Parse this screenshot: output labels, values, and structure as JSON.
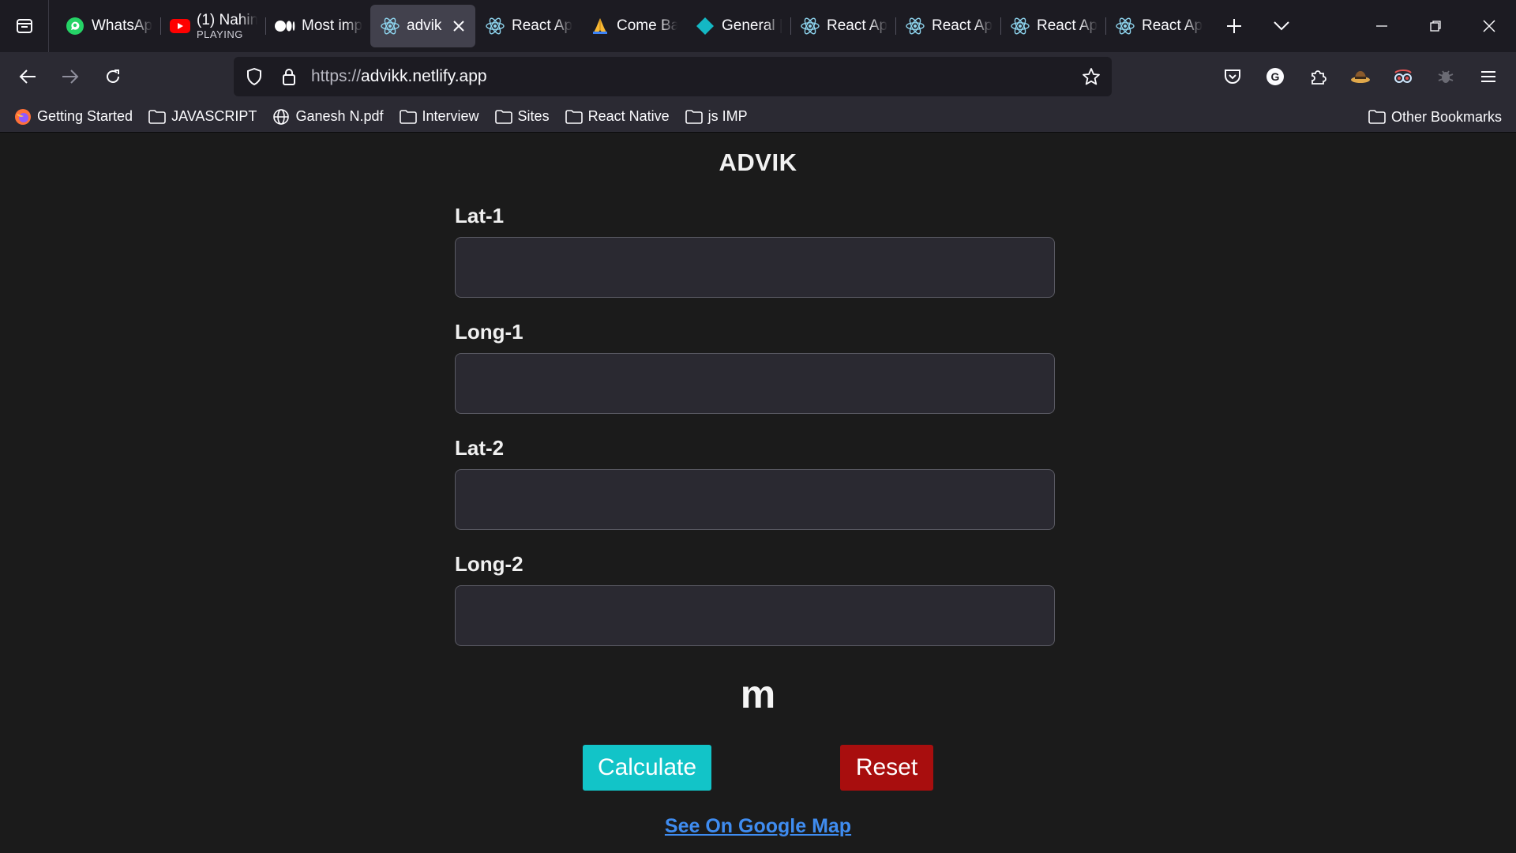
{
  "browser": {
    "tabs": [
      {
        "title": "WhatsApp",
        "icon": "whatsapp-icon"
      },
      {
        "title": "(1) Nahin",
        "subtitle": "PLAYING",
        "icon": "youtube-icon"
      },
      {
        "title": "Most imp",
        "icon": "medium-icon"
      },
      {
        "title": "advik",
        "icon": "react-icon",
        "active": true
      },
      {
        "title": "React Ap",
        "icon": "react-icon"
      },
      {
        "title": "Come Ba",
        "icon": "praying-hands-icon"
      },
      {
        "title": "General |",
        "icon": "diamond-icon"
      },
      {
        "title": "React Ap",
        "icon": "react-icon"
      },
      {
        "title": "React Ap",
        "icon": "react-icon"
      },
      {
        "title": "React Ap",
        "icon": "react-icon"
      },
      {
        "title": "React Ap",
        "icon": "react-icon"
      }
    ],
    "url_scheme": "https://",
    "url_host": "advikk.netlify.app",
    "bookmarks": [
      "Getting Started",
      "JAVASCRIPT",
      "Ganesh N.pdf",
      "Interview",
      "Sites",
      "React Native",
      "js IMP"
    ],
    "other_bookmarks": "Other Bookmarks"
  },
  "app": {
    "title": "ADVIK",
    "fields": [
      {
        "label": "Lat-1",
        "value": ""
      },
      {
        "label": "Long-1",
        "value": ""
      },
      {
        "label": "Lat-2",
        "value": ""
      },
      {
        "label": "Long-2",
        "value": ""
      }
    ],
    "result": "m",
    "calculate_label": "Calculate",
    "reset_label": "Reset",
    "map_link": "See On Google Map"
  },
  "colors": {
    "calculate": "#12c4c8",
    "reset": "#a80e0e",
    "link": "#3f8cf0",
    "page_bg": "#1b1b1b"
  }
}
